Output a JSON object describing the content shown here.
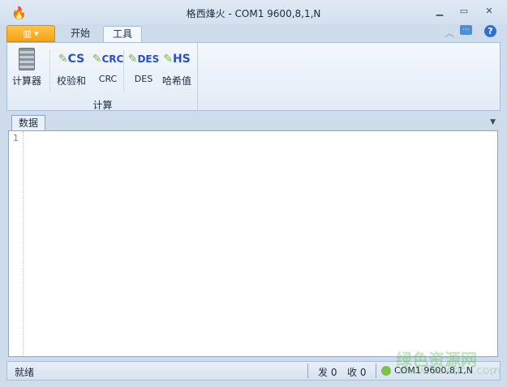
{
  "window": {
    "title": "格西烽火 - COM1  9600,8,1,N"
  },
  "ribbon": {
    "tabs": [
      {
        "label": "开始"
      },
      {
        "label": "工具"
      }
    ],
    "group_label": "计算",
    "buttons": [
      {
        "label": "计算器",
        "badge": ""
      },
      {
        "label": "校验和",
        "badge": "CS"
      },
      {
        "label": "CRC",
        "badge": "CRC"
      },
      {
        "label": "DES",
        "badge": "DES"
      },
      {
        "label": "哈希值",
        "badge": "HS"
      }
    ]
  },
  "document": {
    "tab": "数据",
    "line_numbers": [
      "1"
    ]
  },
  "status": {
    "ready": "就绪",
    "sent": "发 0",
    "received": "收 0",
    "port": "COM1   9600,8,1,N"
  },
  "watermark": {
    "name": "绿色资源网",
    "url": "www.downcc.com"
  }
}
